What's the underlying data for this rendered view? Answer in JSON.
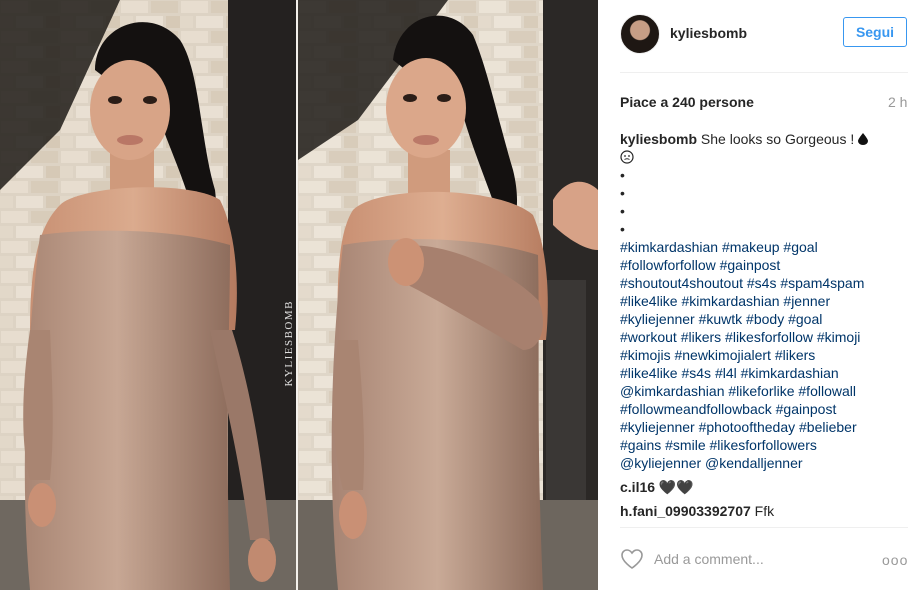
{
  "post": {
    "watermark": "KYLIESBOMB",
    "username": "kyliesbomb",
    "follow_label": "Segui",
    "likes_text": "Piace a 240 persone",
    "time": "2 h",
    "caption": {
      "username": "kyliesbomb",
      "text": "She looks so Gorgeous !",
      "emoji_line": "",
      "bullets": [
        "•",
        "•",
        "•",
        "•"
      ],
      "hashtag_lines": [
        "#kimkardashian #makeup #goal",
        "#followforfollow #gainpost",
        "#shoutout4shoutout #s4s #spam4spam",
        "#like4like #kimkardashian #jenner",
        "#kyliejenner #kuwtk #body #goal",
        "#workout #likers #likesforfollow #kimoji",
        "#kimojis #newkimojialert #likers",
        "#like4like #s4s #l4l #kimkardashian",
        "@kimkardashian #likeforlike #followall",
        "#followmeandfollowback #gainpost",
        "#kyliejenner #photooftheday #belieber",
        "#gains #smile #likesforfollowers",
        "@kyliejenner @kendalljenner"
      ]
    },
    "comments": [
      {
        "user": "c.il16",
        "text": "🖤🖤"
      },
      {
        "user": "h.fani_09903392707",
        "text": "Ffk"
      }
    ],
    "add_comment_placeholder": "Add a comment...",
    "more_label": "ooo",
    "icons": {
      "heart": "heart-icon",
      "drop": "drop-emoji-icon",
      "face": "face-emoji-icon",
      "avatar": "avatar"
    },
    "colors": {
      "link": "#003569",
      "button": "#3897f0",
      "muted": "#999999",
      "text": "#262626"
    }
  }
}
